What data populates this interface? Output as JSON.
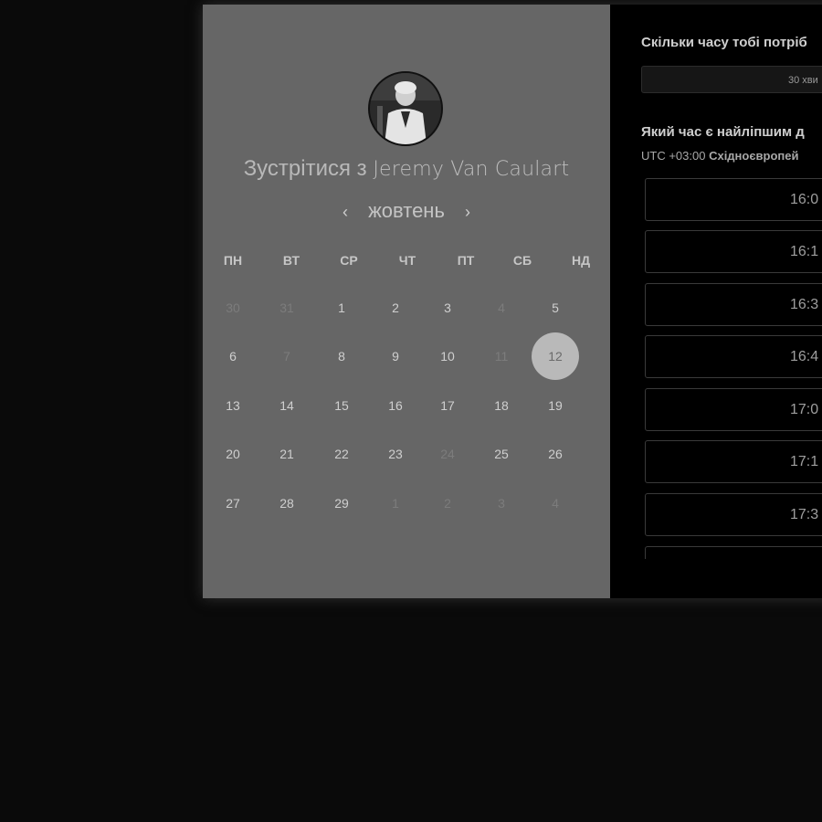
{
  "booking": {
    "meet_prefix": "Зустрітися з",
    "host_name": "Jeremy Van Caulart",
    "avatar_alt": "avatar"
  },
  "calendar": {
    "month": "жовтень",
    "prev_icon": "chevron-left-icon",
    "next_icon": "chevron-right-icon",
    "weekdays": [
      "ПН",
      "ВТ",
      "СР",
      "ЧТ",
      "ПТ",
      "СБ",
      "НД"
    ],
    "selected_day": "12",
    "weeks": [
      [
        {
          "d": "30",
          "dim": true
        },
        {
          "d": "31",
          "dim": true
        },
        {
          "d": "1",
          "dim": false
        },
        {
          "d": "2",
          "dim": false
        },
        {
          "d": "3",
          "dim": false
        },
        {
          "d": "4",
          "dim": true
        },
        {
          "d": "5",
          "dim": false
        }
      ],
      [
        {
          "d": "6",
          "dim": false
        },
        {
          "d": "7",
          "dim": true
        },
        {
          "d": "8",
          "dim": false
        },
        {
          "d": "9",
          "dim": false
        },
        {
          "d": "10",
          "dim": false
        },
        {
          "d": "11",
          "dim": true
        },
        {
          "d": "12",
          "dim": false
        }
      ],
      [
        {
          "d": "13",
          "dim": false
        },
        {
          "d": "14",
          "dim": false
        },
        {
          "d": "15",
          "dim": false
        },
        {
          "d": "16",
          "dim": false
        },
        {
          "d": "17",
          "dim": false
        },
        {
          "d": "18",
          "dim": false
        },
        {
          "d": "19",
          "dim": false
        }
      ],
      [
        {
          "d": "20",
          "dim": false
        },
        {
          "d": "21",
          "dim": false
        },
        {
          "d": "22",
          "dim": false
        },
        {
          "d": "23",
          "dim": false
        },
        {
          "d": "24",
          "dim": true
        },
        {
          "d": "25",
          "dim": false
        },
        {
          "d": "26",
          "dim": false
        }
      ],
      [
        {
          "d": "27",
          "dim": false
        },
        {
          "d": "28",
          "dim": false
        },
        {
          "d": "29",
          "dim": false
        },
        {
          "d": "1",
          "dim": true
        },
        {
          "d": "2",
          "dim": true
        },
        {
          "d": "3",
          "dim": true
        },
        {
          "d": "4",
          "dim": true
        }
      ]
    ]
  },
  "scheduler": {
    "duration_question": "Скільки часу тобі потріб",
    "duration_value": "30 хви",
    "time_question": "Який час є найліпшим д",
    "timezone_offset": "UTC +03:00",
    "timezone_name": "Східноєвропей",
    "slots": [
      "16:0",
      "16:1",
      "16:3",
      "16:4",
      "17:0",
      "17:1",
      "17:3"
    ]
  }
}
